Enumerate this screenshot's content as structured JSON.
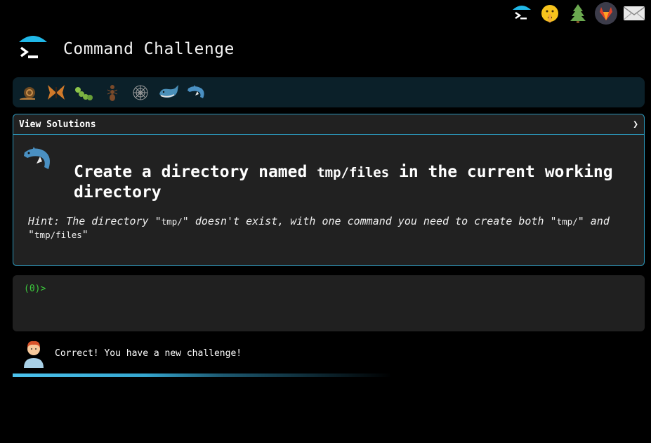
{
  "app": {
    "title": "Command Challenge"
  },
  "top_icons": [
    "terminal-umbrella-icon",
    "shushing-face-icon",
    "evergreen-tree-icon",
    "gitlab-fox-icon",
    "envelope-icon"
  ],
  "levels": [
    "snail-icon",
    "butterfly-icon",
    "caterpillar-icon",
    "ant-icon",
    "web-icon",
    "whale-icon",
    "dolphin-icon"
  ],
  "panel": {
    "solutions_label": "View Solutions",
    "chevron": "❯",
    "challenge_before": "Create a directory named ",
    "challenge_code": "tmp/files",
    "challenge_after": " in the current working directory",
    "hint_1": "Hint: The directory \"",
    "hint_code_1": "tmp/",
    "hint_2": "\" doesn't exist, with one command you need to create both \"",
    "hint_code_2": "tmp/",
    "hint_3": "\" and \"",
    "hint_code_3": "tmp/files",
    "hint_4": "\""
  },
  "terminal": {
    "prompt": "(0)>"
  },
  "status": {
    "message": "Correct! You have a new challenge!",
    "progress": 0.6
  },
  "colors": {
    "accent": "#2b95b8",
    "prompt": "#3cc83c",
    "level_bar": "#0b2029",
    "panel": "#212121"
  }
}
